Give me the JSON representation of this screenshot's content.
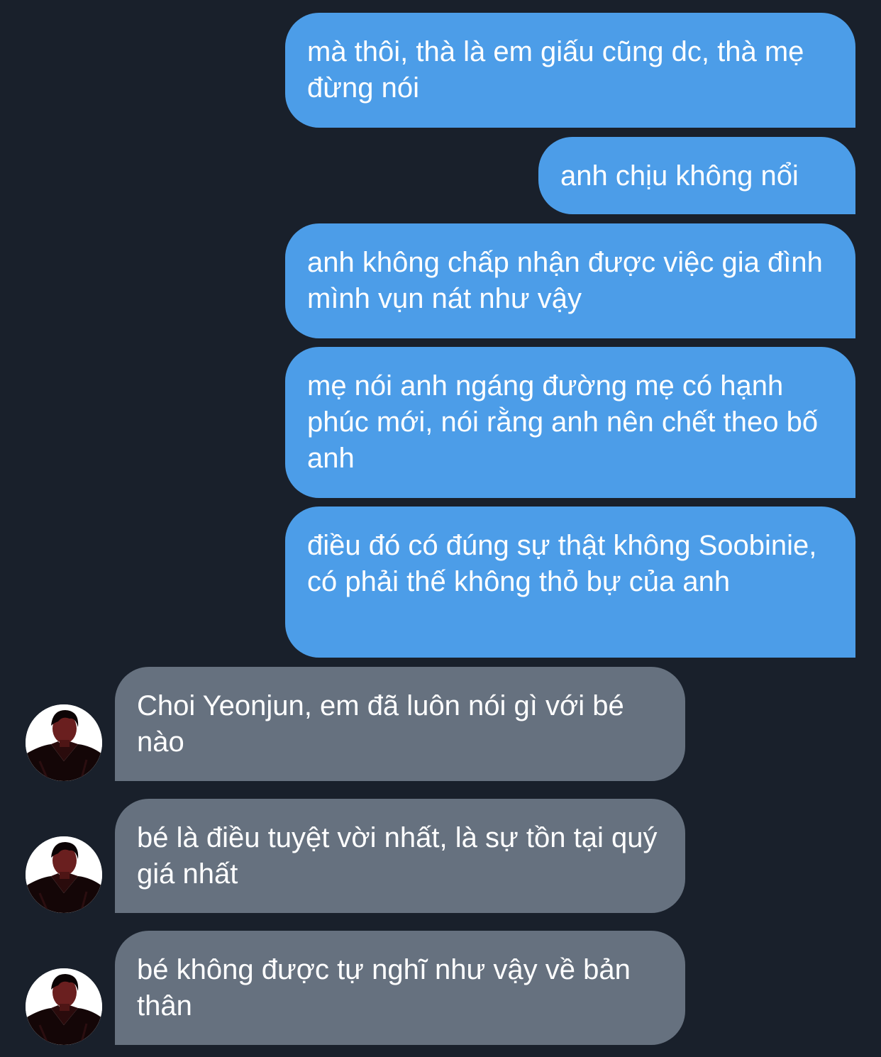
{
  "conversation": {
    "sent_messages": [
      {
        "text": "mà thôi, thà là em giấu cũng dc, thà mẹ đừng nói"
      },
      {
        "text": "anh chịu không nổi"
      },
      {
        "text": "anh không chấp nhận được việc gia đình mình vụn nát như vậy"
      },
      {
        "text": "mẹ nói anh ngáng đường mẹ có hạnh phúc mới, nói rằng anh nên chết theo bố anh"
      },
      {
        "text": "điều đó có đúng sự thật không Soobinie, có phải thế không thỏ bự của anh"
      }
    ],
    "received_messages": [
      {
        "text": "Choi Yeonjun, em đã luôn nói gì với bé nào"
      },
      {
        "text": "bé là điều tuyệt vời nhất, là sự tồn tại quý giá nhất"
      },
      {
        "text": "bé không được tự nghĩ như vậy về bản thân"
      }
    ]
  },
  "colors": {
    "background": "#19202b",
    "sent_bubble": "#4c9de8",
    "received_bubble": "#66717f",
    "text": "#ffffff"
  },
  "icons": {
    "contact_avatar": "avatar-photo"
  }
}
